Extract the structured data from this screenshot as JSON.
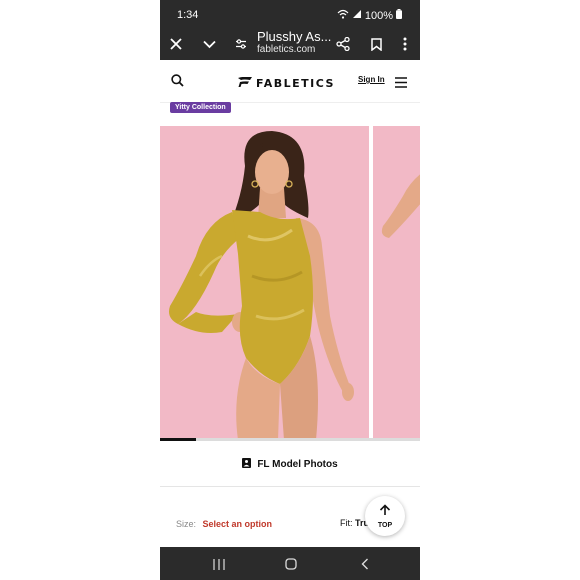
{
  "status_bar": {
    "time": "1:34",
    "battery": "100%",
    "icons": [
      "wifi-icon",
      "signal-icon",
      "battery-icon"
    ]
  },
  "browser": {
    "page_title": "Plusshy As...",
    "url": "fabletics.com",
    "icons": [
      "close-icon",
      "chevron-down-icon",
      "site-settings-icon",
      "share-icon",
      "bookmark-icon",
      "more-menu-icon"
    ]
  },
  "site_header": {
    "logo_text": "FABLETICS",
    "sign_in": "Sign In",
    "icons": [
      "search-icon",
      "hamburger-menu-icon"
    ]
  },
  "product": {
    "badge": "Yitty Collection",
    "gallery_progress": 0.14,
    "model_photos_label": "FL Model Photos",
    "size_label": "Size:",
    "size_value": "Select an option",
    "fit_label": "Fit:",
    "fit_value": "Tru"
  },
  "top_button": {
    "label": "TOP"
  },
  "colors": {
    "dark_bar": "#2b2b2b",
    "photo_background": "#f2b9c6",
    "badge": "#6a3ca1",
    "select_option": "#c0392b",
    "bodysuit": "#c9a92f"
  }
}
